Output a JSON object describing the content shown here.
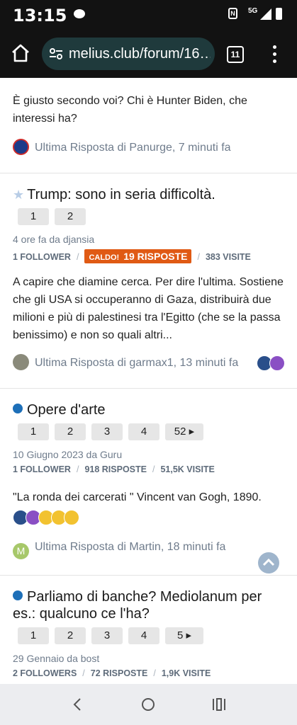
{
  "status": {
    "time": "13:15",
    "network": "5G"
  },
  "browser": {
    "url": "melius.club/forum/16…",
    "tabs": "11"
  },
  "posts": [
    {
      "excerpt": "È giusto secondo voi? Chi è Hunter Biden, che interessi ha?",
      "last_reply": "Ultima Risposta di Panurge, 7 minuti fa"
    },
    {
      "title": "Trump: sono in seria difficoltà.",
      "pages": [
        "1",
        "2"
      ],
      "date": "4 ore fa da djansia",
      "followers": "1 FOLLOWER",
      "hot_label": "CALDO!",
      "replies": "19 RISPOSTE",
      "views": "383 VISITE",
      "excerpt": "A capire che diamine cerca. Per dire l'ultima. Sostiene che gli USA si occuperanno di Gaza, distribuirà due milioni e più di palestinesi tra l'Egitto (che se la passa benissimo) e non so quali altri...",
      "last_reply": "Ultima Risposta di garmax1, 13 minuti fa"
    },
    {
      "title": "Opere d'arte",
      "pages": [
        "1",
        "2",
        "3",
        "4",
        "52 ▸"
      ],
      "date": "10 Giugno 2023 da Guru",
      "followers": "1 FOLLOWER",
      "replies": "918 RISPOSTE",
      "views": "51,5K VISITE",
      "excerpt": "\"La ronda dei carcerati \" Vincent van Gogh, 1890.",
      "avatar_letter": "M",
      "last_reply": "Ultima Risposta di Martin, 18 minuti fa"
    },
    {
      "title_line1": "Parliamo di banche? Mediolanum per",
      "title_line2": "es.: qualcuno ce l'ha?",
      "pages": [
        "1",
        "2",
        "3",
        "4",
        "5 ▸"
      ],
      "date": "29 Gennaio da bost",
      "followers": "2 FOLLOWERS",
      "replies": "72 RISPOSTE",
      "views": "1,9K VISITE"
    }
  ],
  "colors": {
    "accent": "#1d6fb8",
    "hot": "#e05a14",
    "muted": "#6f7c8c"
  }
}
